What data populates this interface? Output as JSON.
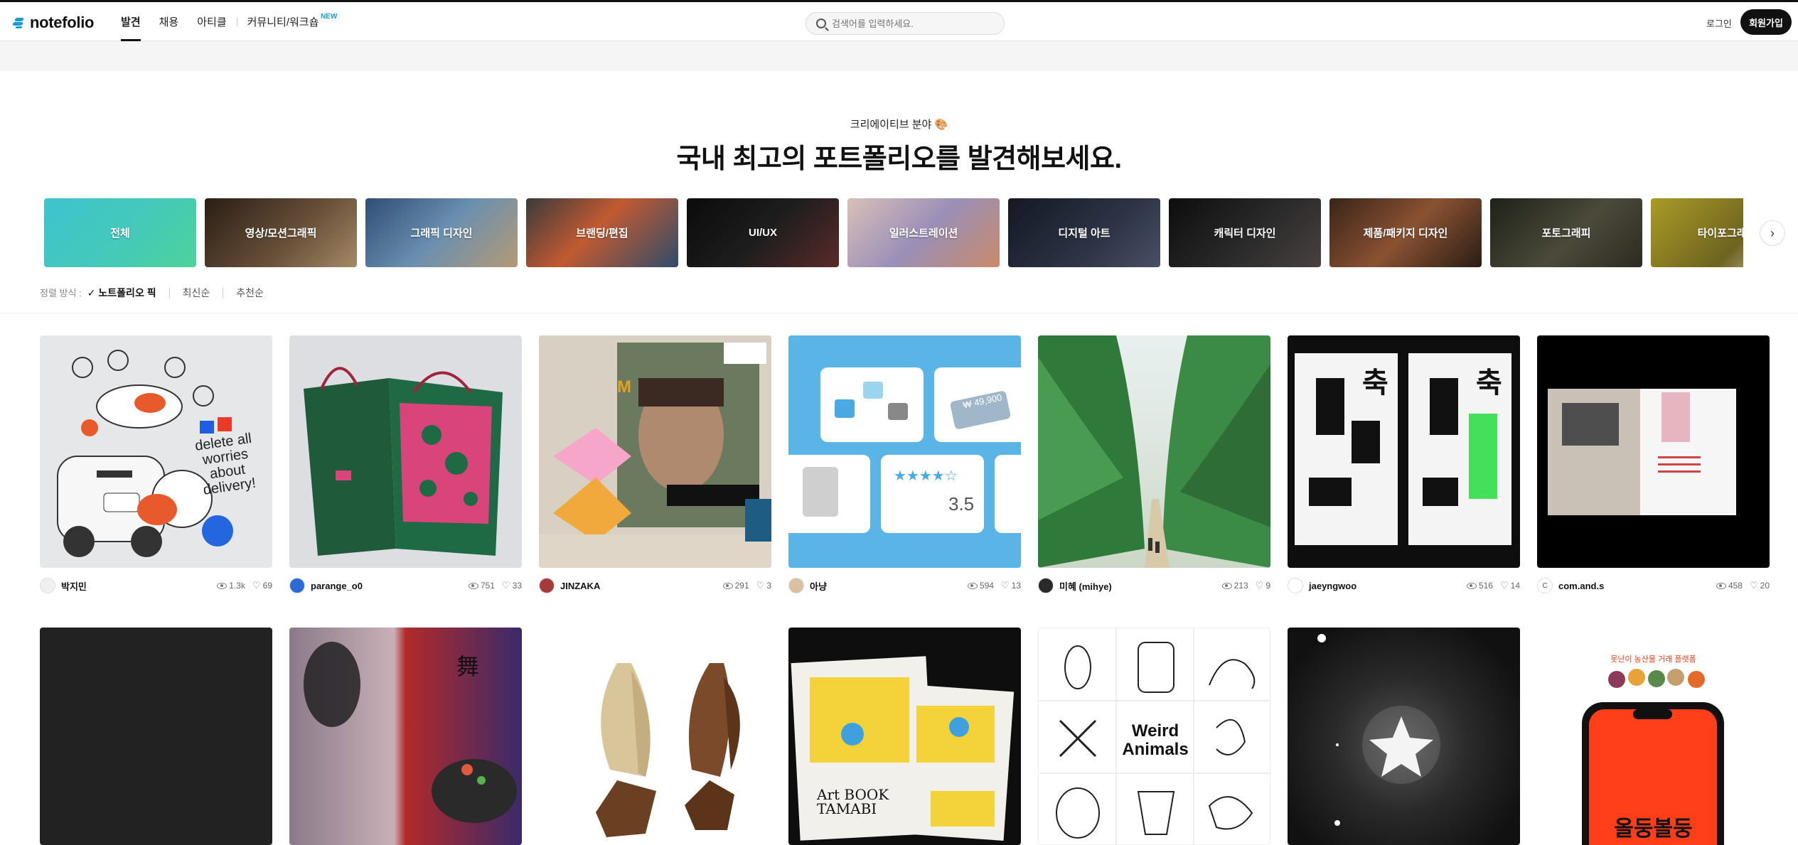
{
  "header": {
    "logo": "notefolio",
    "nav": [
      "발견",
      "채용",
      "아티클",
      "커뮤니티/워크숍"
    ],
    "nav_new_badge": "NEW",
    "search_placeholder": "검색어를 입력하세요.",
    "login": "로그인",
    "signup": "회원가입"
  },
  "hero": {
    "kicker": "크리에이티브 분야 🎨",
    "title": "국내 최고의 포트폴리오를 발견해보세요."
  },
  "categories": [
    {
      "label": "전체",
      "color": "#3fc6c8"
    },
    {
      "label": "영상/모션그래픽",
      "color": "#5a4634"
    },
    {
      "label": "그래픽 디자인",
      "color": "#4a6a8c"
    },
    {
      "label": "브랜딩/편집",
      "color": "#7a5a48"
    },
    {
      "label": "UI/UX",
      "color": "#111111"
    },
    {
      "label": "일러스트레이션",
      "color": "#b79aa0"
    },
    {
      "label": "디지털 아트",
      "color": "#2a2d38"
    },
    {
      "label": "캐릭터 디자인",
      "color": "#1c1c1c"
    },
    {
      "label": "제품/패키지 디자인",
      "color": "#5b3e2e"
    },
    {
      "label": "포토그래피",
      "color": "#3c3b32"
    },
    {
      "label": "타이포그래피",
      "color": "#8b7b2a"
    }
  ],
  "sort": {
    "label": "정렬 방식 :",
    "options": [
      "노트폴리오 픽",
      "최신순",
      "추천순"
    ]
  },
  "cards_row1": [
    {
      "author": "박지민",
      "views": "1.3k",
      "likes": "69"
    },
    {
      "author": "parange_o0",
      "views": "751",
      "likes": "33"
    },
    {
      "author": "JINZAKA",
      "views": "291",
      "likes": "3"
    },
    {
      "author": "아냥",
      "views": "594",
      "likes": "13"
    },
    {
      "author": "미혜 (mihye)",
      "views": "213",
      "likes": "9"
    },
    {
      "author": "jaeyngwoo",
      "views": "516",
      "likes": "14"
    },
    {
      "author": "com.and.s",
      "views": "458",
      "likes": "20"
    }
  ],
  "thumb_text": {
    "delivery": "delete all worries about delivery!",
    "price": "₩ 49,900",
    "rating": "3.5",
    "weird": "Weird Animals",
    "artbook": "Art BOOK TAMABI",
    "hanja": "舞",
    "poster_title": "올둥볼둥",
    "poster_top": "못난이 농산물 거래 플랫폼"
  }
}
